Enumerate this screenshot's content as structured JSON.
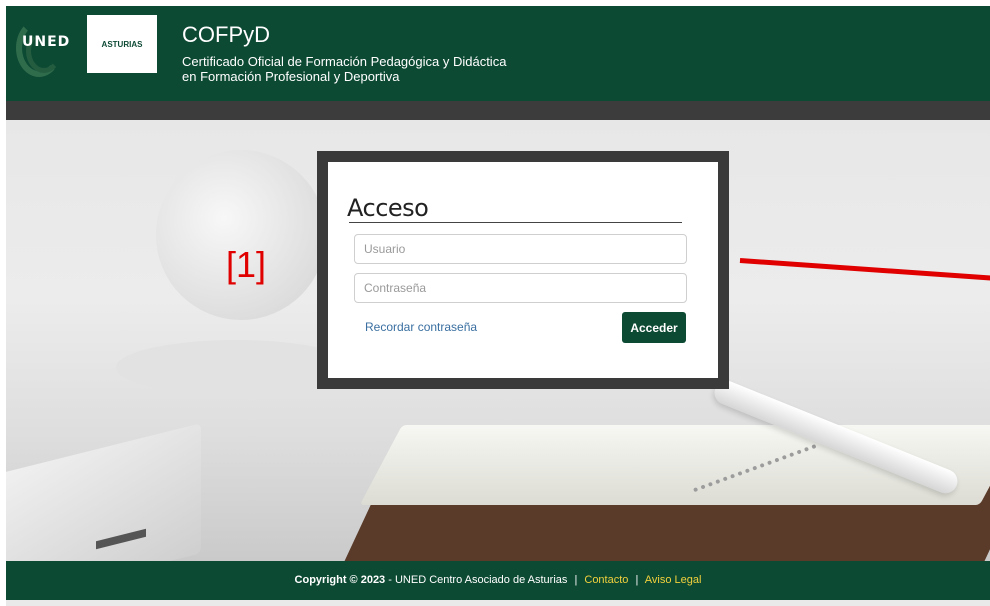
{
  "header": {
    "logo_uned": "UNED",
    "logo_region": "ASTURIAS",
    "title": "COFPyD",
    "subtitle_line1": "Certificado Oficial de Formación Pedagógica y Didáctica",
    "subtitle_line2": "en Formación Profesional y Deportiva"
  },
  "annotation": {
    "marker": "[1]"
  },
  "login": {
    "title": "Acceso",
    "username_placeholder": "Usuario",
    "password_placeholder": "Contraseña",
    "forgot_label": "Recordar contraseña",
    "submit_label": "Acceder"
  },
  "footer": {
    "copyright": "Copyright © 2023",
    "org": "- UNED Centro Asociado de Asturias",
    "contact_label": "Contacto",
    "legal_label": "Aviso Legal"
  },
  "colors": {
    "brand_green": "#0d4a34",
    "footer_link": "#f2d13c",
    "annotation_red": "#e00000"
  }
}
